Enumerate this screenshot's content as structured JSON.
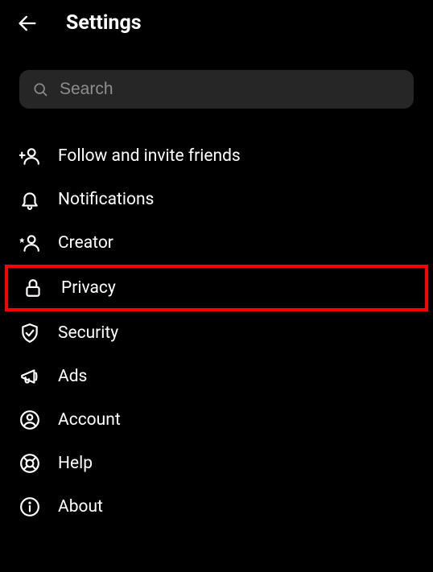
{
  "header": {
    "title": "Settings"
  },
  "search": {
    "placeholder": "Search"
  },
  "menu": {
    "follow_invite": "Follow and invite friends",
    "notifications": "Notifications",
    "creator": "Creator",
    "privacy": "Privacy",
    "security": "Security",
    "ads": "Ads",
    "account": "Account",
    "help": "Help",
    "about": "About"
  },
  "highlighted_item": "privacy"
}
